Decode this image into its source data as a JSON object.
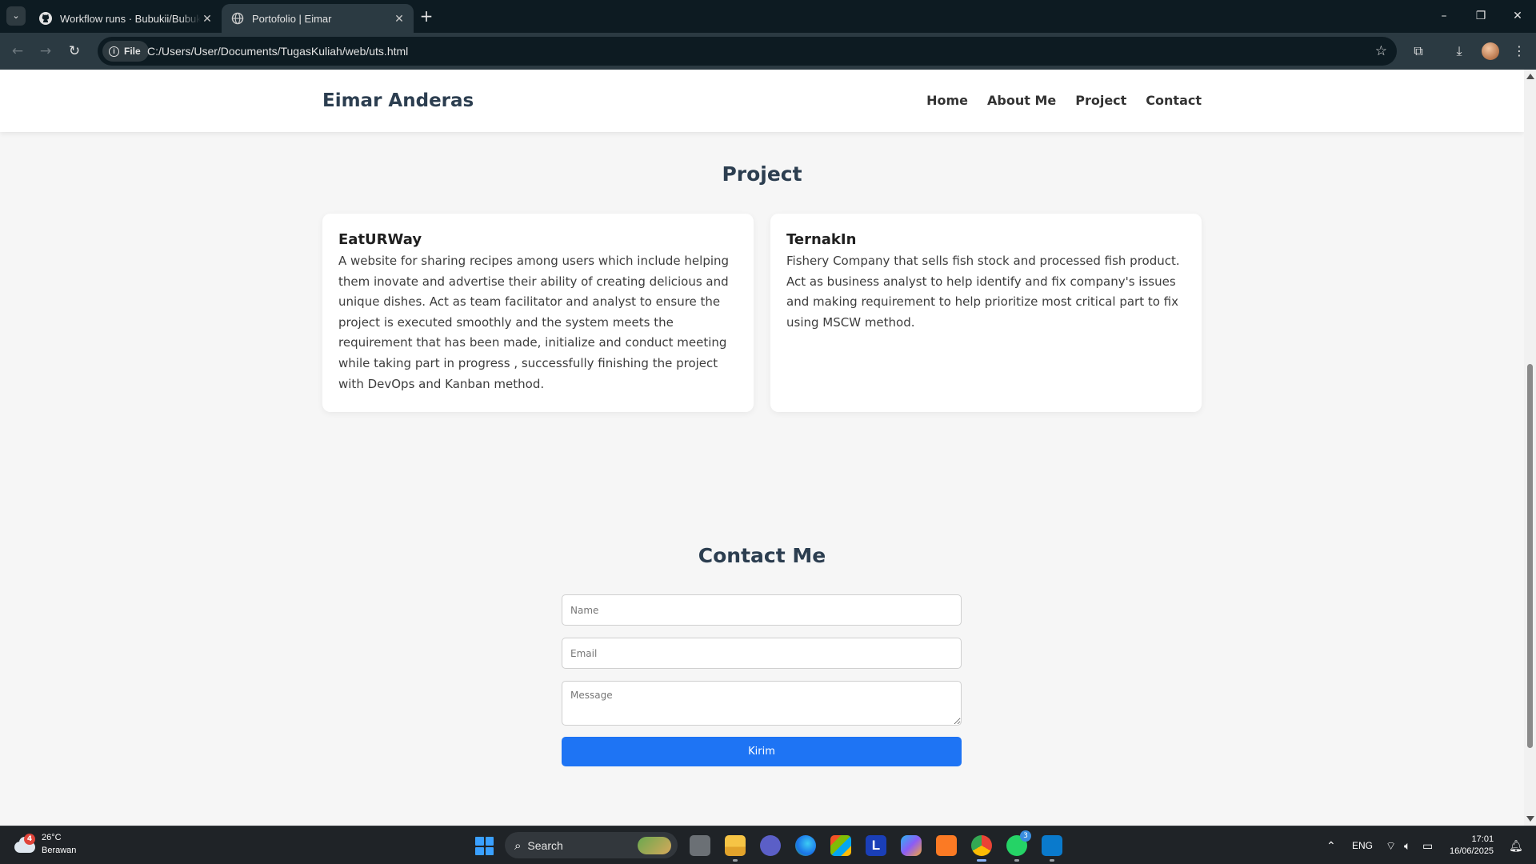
{
  "browser": {
    "tabs": [
      {
        "title": "Workflow runs · Bubukii/Bubukii",
        "icon": "github-icon",
        "active": false
      },
      {
        "title": "Portofolio | Eimar",
        "icon": "globe-icon",
        "active": true
      }
    ],
    "url_chip": "File",
    "url": "C:/Users/User/Documents/TugasKuliah/web/uts.html"
  },
  "site": {
    "brand": "Eimar Anderas",
    "nav": [
      "Home",
      "About Me",
      "Project",
      "Contact"
    ],
    "project_section": {
      "title": "Project",
      "projects": [
        {
          "name": "EatURWay",
          "description": "A website for sharing recipes among users which include helping them inovate and advertise their ability of creating delicious and unique dishes. Act as team facilitator and analyst to ensure the project is executed smoothly and the system meets the requirement that has been made, initialize and conduct meeting while taking part in progress , successfully finishing the project with DevOps and Kanban method."
        },
        {
          "name": "TernakIn",
          "description": "Fishery Company that sells fish stock and processed fish product. Act as business analyst to help identify and fix company's issues and making requirement to help prioritize most critical part to fix using MSCW method."
        }
      ]
    },
    "contact_section": {
      "title": "Contact Me",
      "name_placeholder": "Name",
      "email_placeholder": "Email",
      "message_placeholder": "Message",
      "submit_label": "Kirim"
    }
  },
  "taskbar": {
    "weather": {
      "temp": "26°C",
      "condition": "Berawan",
      "badge": "4"
    },
    "search_label": "Search",
    "apps": [
      "task-view-icon",
      "file-explorer-icon",
      "teams-icon",
      "edge-icon",
      "store-icon",
      "l-app-icon",
      "copilot-icon",
      "xampp-icon",
      "chrome-icon",
      "whatsapp-icon",
      "vscode-icon"
    ],
    "whatsapp_badge": "3",
    "language": "ENG",
    "time": "17:01",
    "date": "16/06/2025"
  },
  "colors": {
    "accent_button": "#1e74f4",
    "heading": "#2c3e50",
    "page_background": "#f6f6f6"
  }
}
